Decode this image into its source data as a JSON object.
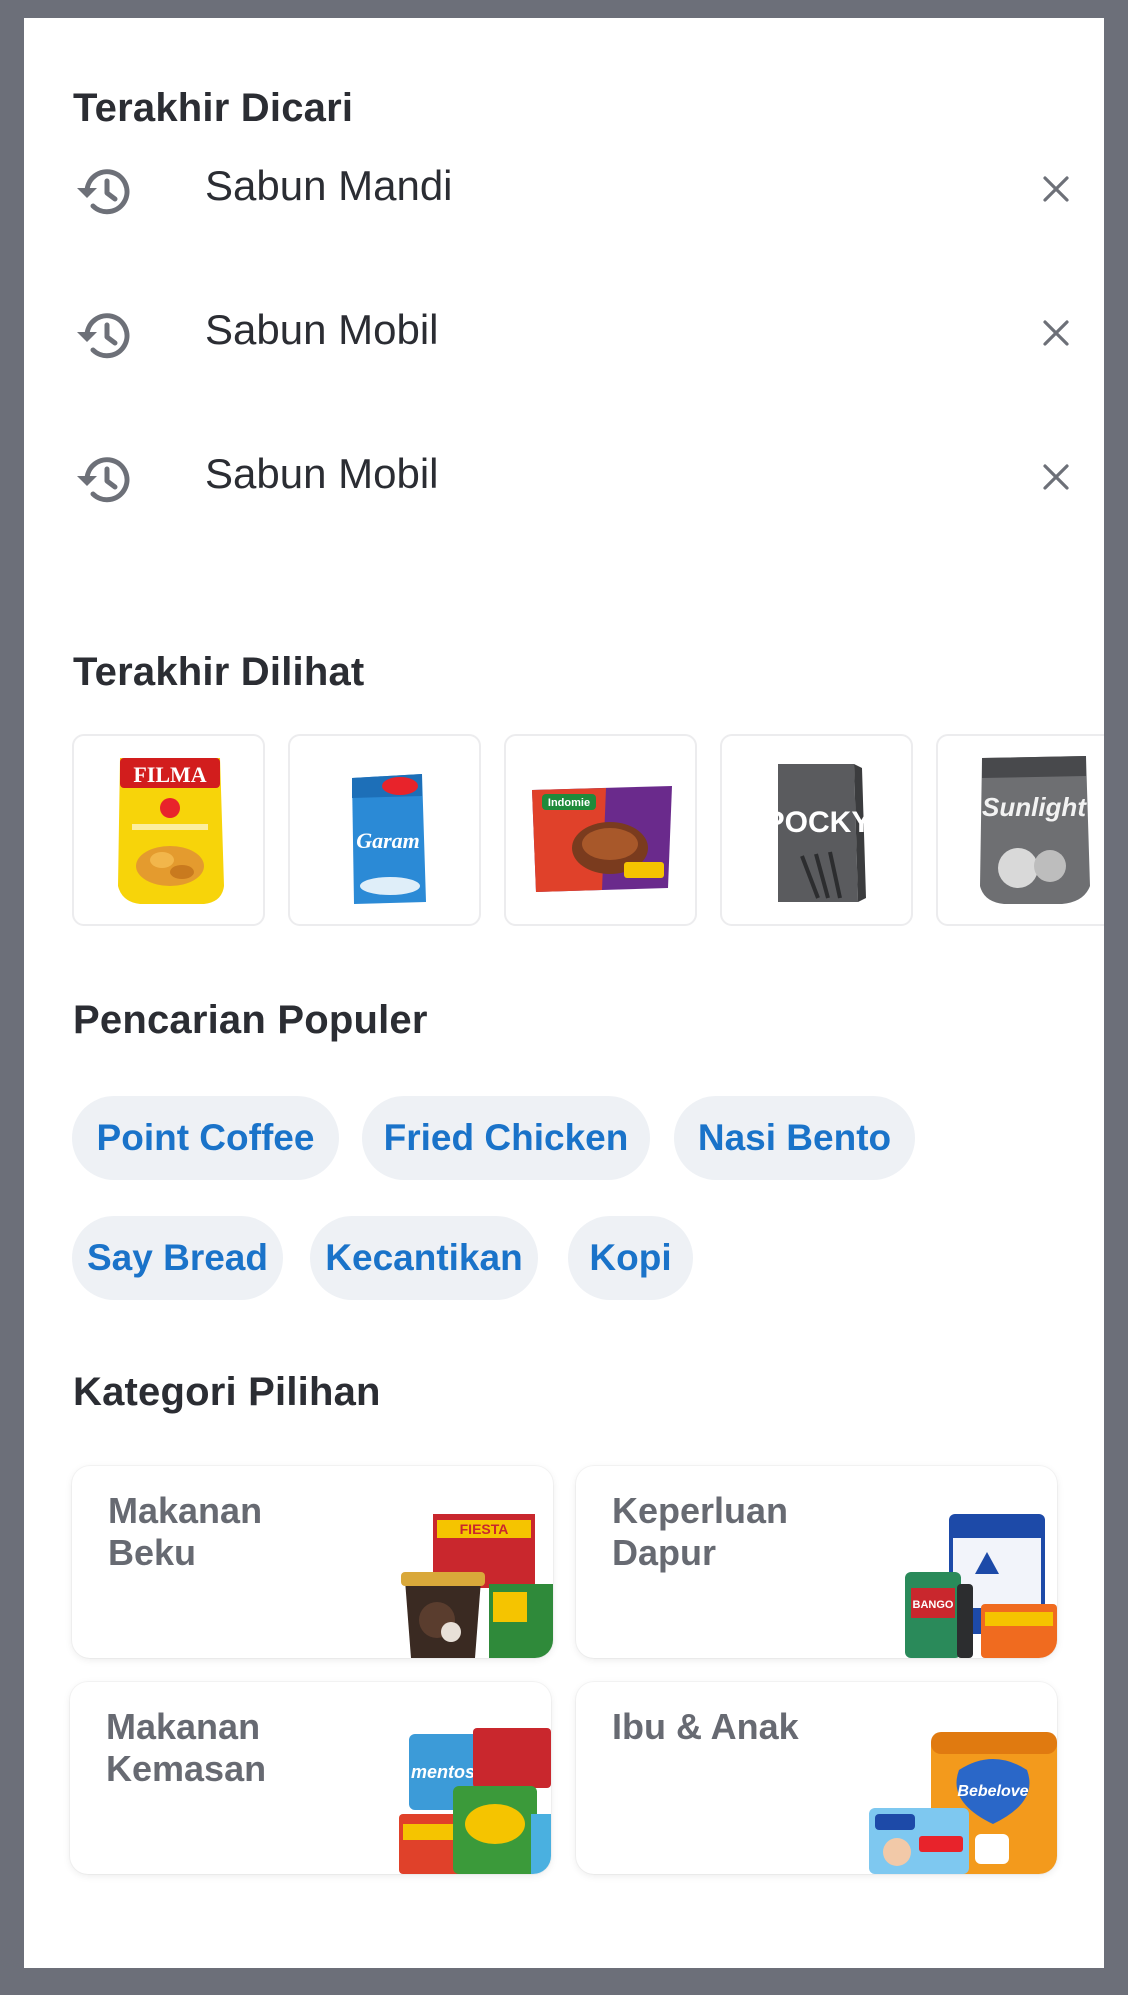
{
  "recent_searches": {
    "title": "Terakhir Dicari",
    "items": [
      {
        "label": "Sabun Mandi"
      },
      {
        "label": "Sabun Mobil"
      },
      {
        "label": "Sabun Mobil"
      }
    ]
  },
  "recently_viewed": {
    "title": "Terakhir Dilihat",
    "products": [
      {
        "name": "FILMA",
        "icon": "cooking-oil-pouch-image"
      },
      {
        "name": "Garam",
        "icon": "salt-pack-image"
      },
      {
        "name": "Indomie",
        "icon": "instant-noodle-pack-image"
      },
      {
        "name": "POCKY",
        "icon": "pocky-box-image"
      },
      {
        "name": "Sunlight",
        "icon": "dish-soap-pouch-image"
      }
    ]
  },
  "popular_searches": {
    "title": "Pencarian Populer",
    "chips": [
      "Point Coffee",
      "Fried Chicken",
      "Nasi Bento",
      "Say Bread",
      "Kecantikan",
      "Kopi"
    ]
  },
  "categories": {
    "title": "Kategori Pilihan",
    "items": [
      {
        "label": "Makanan Beku",
        "brand": "FIESTA"
      },
      {
        "label": "Keperluan Dapur",
        "brand": "BANGO"
      },
      {
        "label": "Makanan Kemasan",
        "brand": "mentos"
      },
      {
        "label": "Ibu & Anak",
        "brand": "Bebelove"
      }
    ]
  },
  "colors": {
    "chip_text": "#1a73c9",
    "chip_bg": "#eef1f5",
    "title": "#2b2d33",
    "frame": "#6c6f79"
  }
}
